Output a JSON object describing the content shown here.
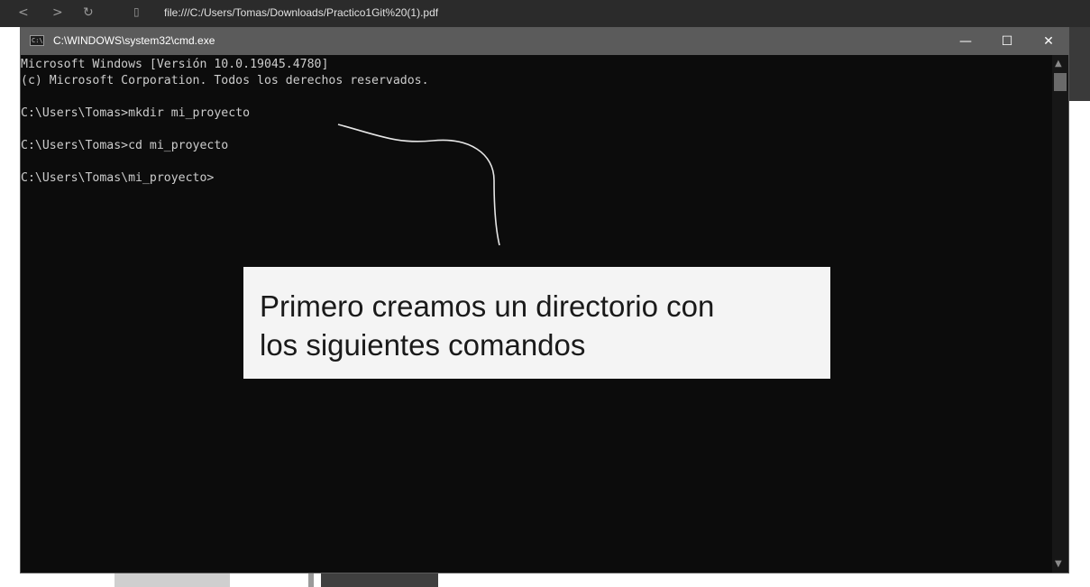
{
  "browser": {
    "back_icon": "chevron-left-icon",
    "forward_icon": "chevron-right-icon",
    "reload_icon": "reload-icon",
    "url": "file:///C:/Users/Tomas/Downloads/Practico1Git%20(1).pdf"
  },
  "window": {
    "title": "C:\\WINDOWS\\system32\\cmd.exe",
    "minimize": "—",
    "maximize": "☐",
    "close": "✕"
  },
  "console": {
    "lines": [
      "Microsoft Windows [Versión 10.0.19045.4780]",
      "(c) Microsoft Corporation. Todos los derechos reservados.",
      "",
      "C:\\Users\\Tomas>mkdir mi_proyecto",
      "",
      "C:\\Users\\Tomas>cd mi_proyecto",
      "",
      "C:\\Users\\Tomas\\mi_proyecto>"
    ]
  },
  "annotation": {
    "line1": "Primero creamos un directorio con",
    "line2": "los siguientes comandos"
  },
  "colors": {
    "console_bg": "#0c0c0c",
    "console_text": "#cccccc",
    "titlebar": "#5b5b5b",
    "callout_bg": "#f4f4f4"
  }
}
